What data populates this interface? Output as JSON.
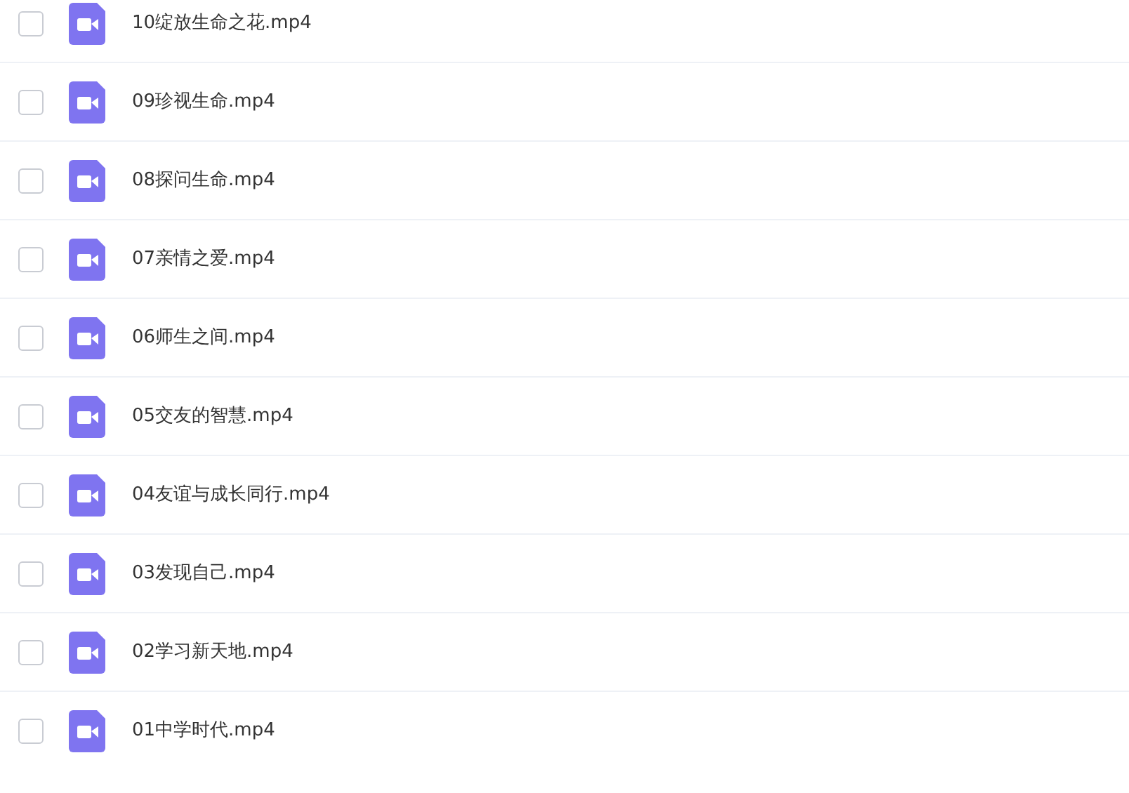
{
  "files": [
    {
      "name": "10绽放生命之花.mp4",
      "checked": false
    },
    {
      "name": "09珍视生命.mp4",
      "checked": false
    },
    {
      "name": "08探问生命.mp4",
      "checked": false
    },
    {
      "name": "07亲情之爱.mp4",
      "checked": false
    },
    {
      "name": "06师生之间.mp4",
      "checked": false
    },
    {
      "name": "05交友的智慧.mp4",
      "checked": false
    },
    {
      "name": "04友谊与成长同行.mp4",
      "checked": false
    },
    {
      "name": "03发现自己.mp4",
      "checked": false
    },
    {
      "name": "02学习新天地.mp4",
      "checked": false
    },
    {
      "name": "01中学时代.mp4",
      "checked": false
    }
  ]
}
